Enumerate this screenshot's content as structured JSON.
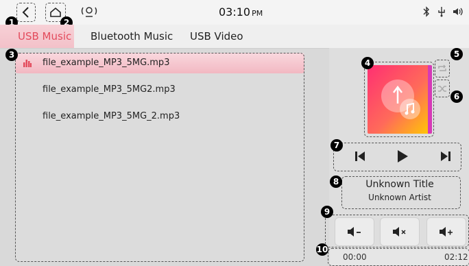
{
  "status": {
    "time": "03:10",
    "ampm": "PM"
  },
  "tabs": [
    {
      "label": "USB Music",
      "active": true
    },
    {
      "label": "Bluetooth Music",
      "active": false
    },
    {
      "label": "USB Video",
      "active": false
    }
  ],
  "badges": [
    "1",
    "2",
    "3",
    "4",
    "5",
    "6",
    "7",
    "8",
    "9",
    "10"
  ],
  "playlist": [
    {
      "name": "file_example_MP3_5MG.mp3",
      "active": true
    },
    {
      "name": "file_example_MP3_5MG2.mp3",
      "active": false
    },
    {
      "name": "file_example_MP3_5MG_2.mp3",
      "active": false
    }
  ],
  "track": {
    "title": "Unknown Title",
    "artist": "Unknown Artist"
  },
  "progress": {
    "current": "00:00",
    "total": "02:12"
  },
  "colors": {
    "accent": "#e34b5c",
    "album_from": "#ff2f72",
    "album_to": "#ffcc00"
  }
}
